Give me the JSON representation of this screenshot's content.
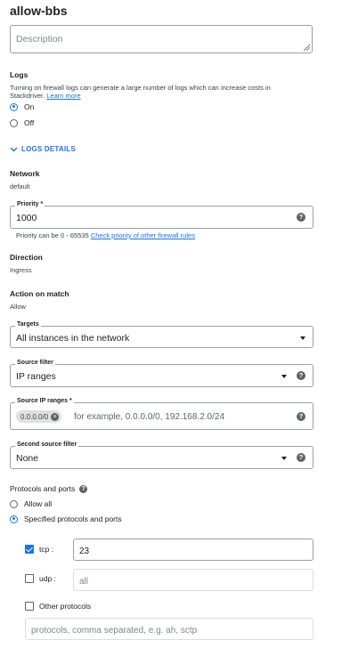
{
  "title": "allow-bbs",
  "description": {
    "placeholder": "Description"
  },
  "logs": {
    "label": "Logs",
    "help_text": "Turning on firewall logs can generate a large number of logs which can increase costs in Stackdriver.",
    "learn_more": "Learn more",
    "options": [
      {
        "label": "On",
        "selected": true
      },
      {
        "label": "Off",
        "selected": false
      }
    ]
  },
  "logs_details": {
    "label": "LOGS DETAILS",
    "icon": "chevron-down-icon"
  },
  "network": {
    "label": "Network",
    "value": "default"
  },
  "priority": {
    "label": "Priority *",
    "value": "1000",
    "hint": "Priority can be 0 - 65535",
    "hint_link": "Check priority of other firewall rules"
  },
  "direction": {
    "label": "Direction",
    "value": "Ingress"
  },
  "action": {
    "label": "Action on match",
    "value": "Allow"
  },
  "targets": {
    "label": "Targets",
    "value": "All instances in the network"
  },
  "source_filter": {
    "label": "Source filter",
    "value": "IP ranges"
  },
  "source_ip_ranges": {
    "label": "Source IP ranges *",
    "chip": "0.0.0.0/0",
    "placeholder": "for example, 0.0.0.0/0, 192.168.2.0/24"
  },
  "second_source_filter": {
    "label": "Second source filter",
    "value": "None"
  },
  "protocols": {
    "label": "Protocols and ports",
    "options": [
      {
        "label": "Allow all",
        "selected": false
      },
      {
        "label": "Specified protocols and ports",
        "selected": true
      }
    ],
    "tcp": {
      "label": "tcp :",
      "checked": true,
      "value": "23"
    },
    "udp": {
      "label": "udp :",
      "checked": false,
      "placeholder": "all"
    },
    "other": {
      "label": "Other protocols",
      "checked": false,
      "placeholder": "protocols, comma separated, e.g. ah, sctp"
    }
  },
  "colors": {
    "accent": "#1a73e8",
    "border": "#9aa0a6",
    "text": "#202124"
  }
}
